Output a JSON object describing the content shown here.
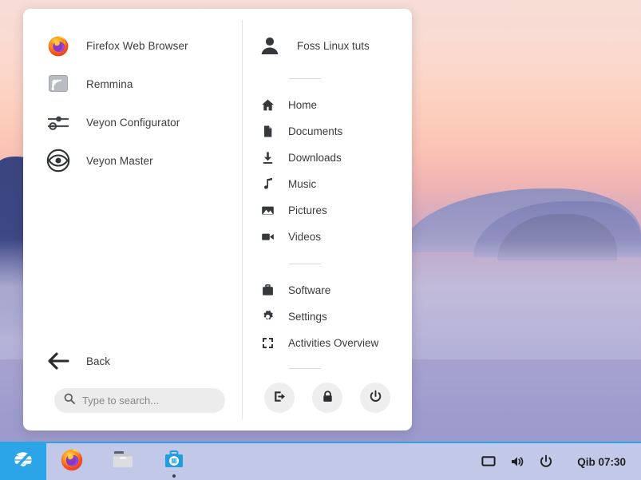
{
  "desktop": {
    "wallpaper_name": "sunset-mountains-fog",
    "wallpaper_colors": {
      "sky_top": "#f7ddd6",
      "sky_mid": "#fcccbb",
      "sky_low": "#c3a8c8",
      "mountain_dark": "#3b4680",
      "fog": "#c6c2df"
    }
  },
  "menu": {
    "left_panel": {
      "apps": [
        {
          "label": "Firefox Web Browser",
          "icon": "firefox-icon"
        },
        {
          "label": "Remmina",
          "icon": "remmina-icon"
        },
        {
          "label": "Veyon Configurator",
          "icon": "sliders-icon"
        },
        {
          "label": "Veyon Master",
          "icon": "eye-icon"
        }
      ],
      "back": {
        "label": "Back",
        "icon": "arrow-left-icon"
      },
      "search": {
        "value": "",
        "placeholder": "Type to search...",
        "icon": "search-icon"
      }
    },
    "right_panel": {
      "user": {
        "name": "Foss Linux tuts",
        "icon": "user-avatar-icon"
      },
      "places": [
        {
          "label": "Home",
          "icon": "home-icon"
        },
        {
          "label": "Documents",
          "icon": "document-icon"
        },
        {
          "label": "Downloads",
          "icon": "download-icon"
        },
        {
          "label": "Music",
          "icon": "music-note-icon"
        },
        {
          "label": "Pictures",
          "icon": "image-icon"
        },
        {
          "label": "Videos",
          "icon": "video-camera-icon"
        }
      ],
      "system": [
        {
          "label": "Software",
          "icon": "briefcase-icon"
        },
        {
          "label": "Settings",
          "icon": "gear-icon"
        },
        {
          "label": "Activities Overview",
          "icon": "expand-brackets-icon"
        }
      ],
      "session_buttons": [
        {
          "name": "log-out",
          "icon": "logout-arrow-icon"
        },
        {
          "name": "lock-screen",
          "icon": "padlock-icon"
        },
        {
          "name": "power-off",
          "icon": "power-icon"
        }
      ]
    }
  },
  "taskbar": {
    "start_button": {
      "label": "Zorin Menu",
      "icon": "zorin-logo-icon",
      "accent": "#2ca5e8"
    },
    "launchers": [
      {
        "label": "Firefox Web Browser",
        "icon": "firefox-icon",
        "running": false
      },
      {
        "label": "Files",
        "icon": "file-manager-icon",
        "running": false
      },
      {
        "label": "Software",
        "icon": "software-store-icon",
        "running": true
      }
    ],
    "tray": [
      {
        "label": "Display",
        "icon": "monitor-icon"
      },
      {
        "label": "Volume",
        "icon": "speaker-icon"
      },
      {
        "label": "Power",
        "icon": "power-icon"
      }
    ],
    "clock": "Qib 07:30",
    "background": "#c2c8e8",
    "top_border": "#2fa3e3"
  }
}
